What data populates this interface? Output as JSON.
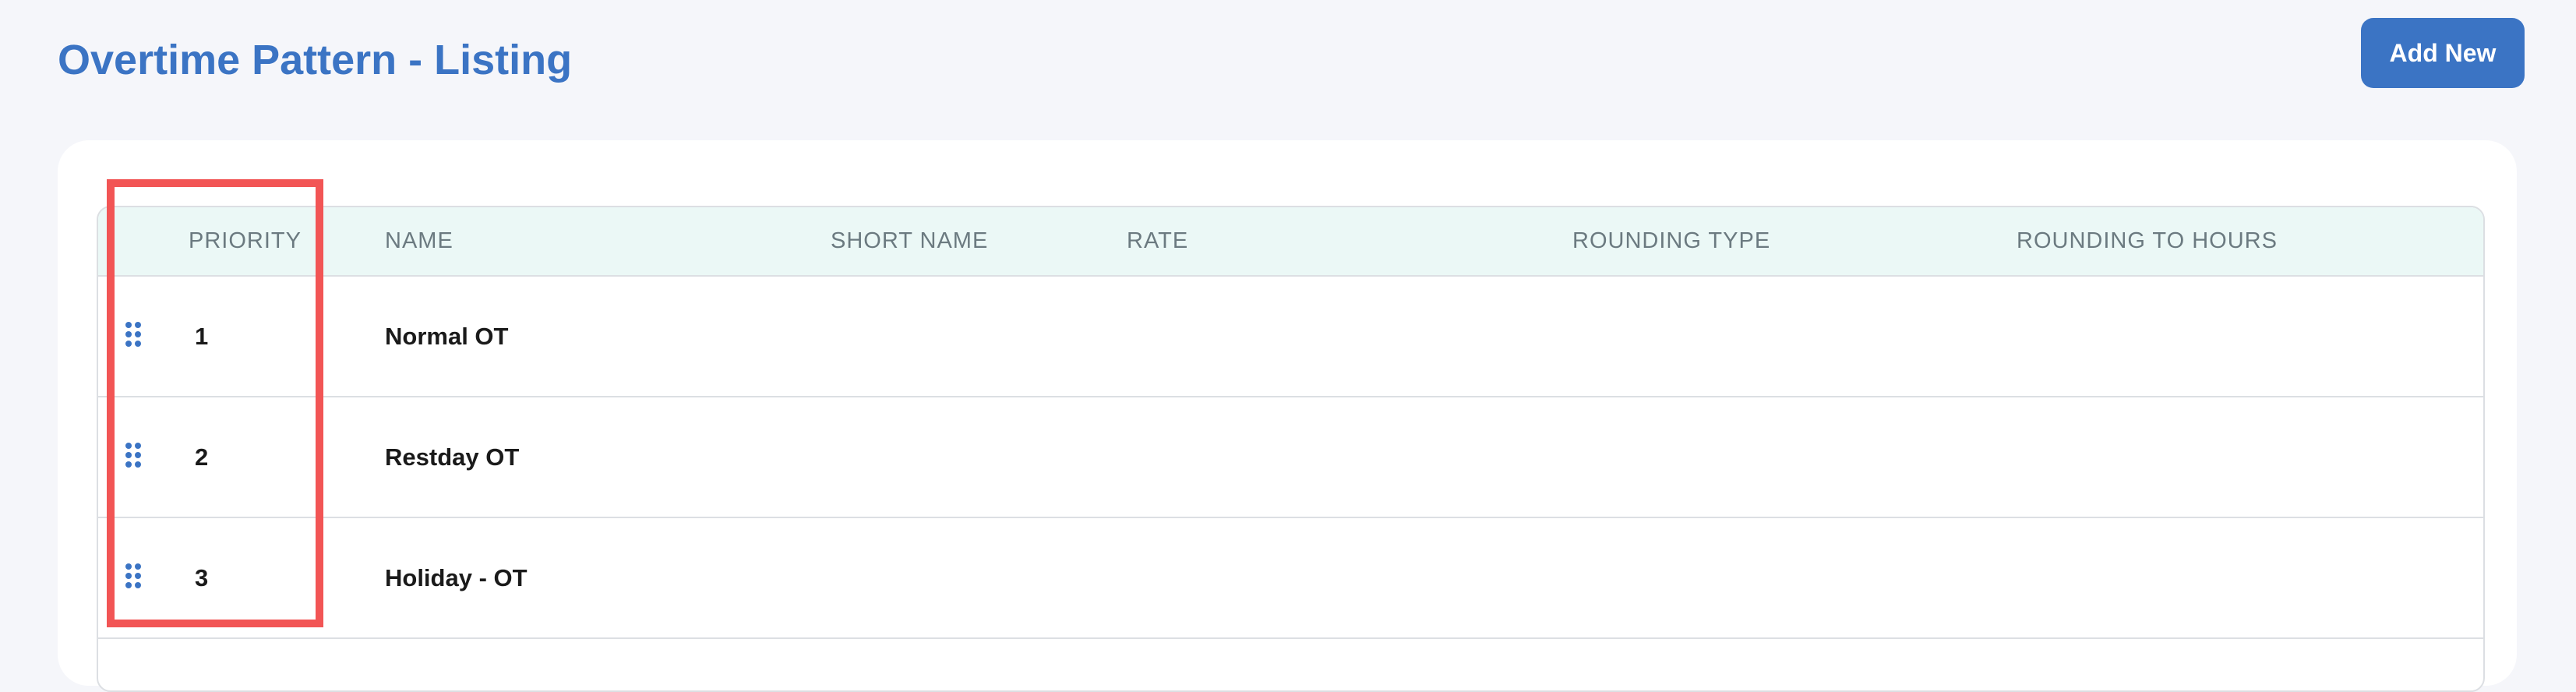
{
  "page": {
    "title": "Overtime Pattern - Listing",
    "add_button_label": "Add New"
  },
  "table": {
    "columns": [
      "PRIORITY",
      "NAME",
      "SHORT NAME",
      "RATE",
      "ROUNDING TYPE",
      "ROUNDING TO HOURS"
    ],
    "rows": [
      {
        "priority": "1",
        "name": "Normal OT",
        "short_name": "",
        "rate": "",
        "rounding_type": "",
        "rounding_to_hours": ""
      },
      {
        "priority": "2",
        "name": "Restday OT",
        "short_name": "",
        "rate": "",
        "rounding_type": "",
        "rounding_to_hours": ""
      },
      {
        "priority": "3",
        "name": "Holiday - OT",
        "short_name": "",
        "rate": "",
        "rounding_type": "",
        "rounding_to_hours": ""
      }
    ]
  },
  "icons": {
    "row_handle": "drag-handle-icon"
  },
  "colors": {
    "primary": "#3b74c4",
    "header_background": "#ebf8f6",
    "highlight": "#f25555",
    "page_background": "#f5f6fa"
  }
}
